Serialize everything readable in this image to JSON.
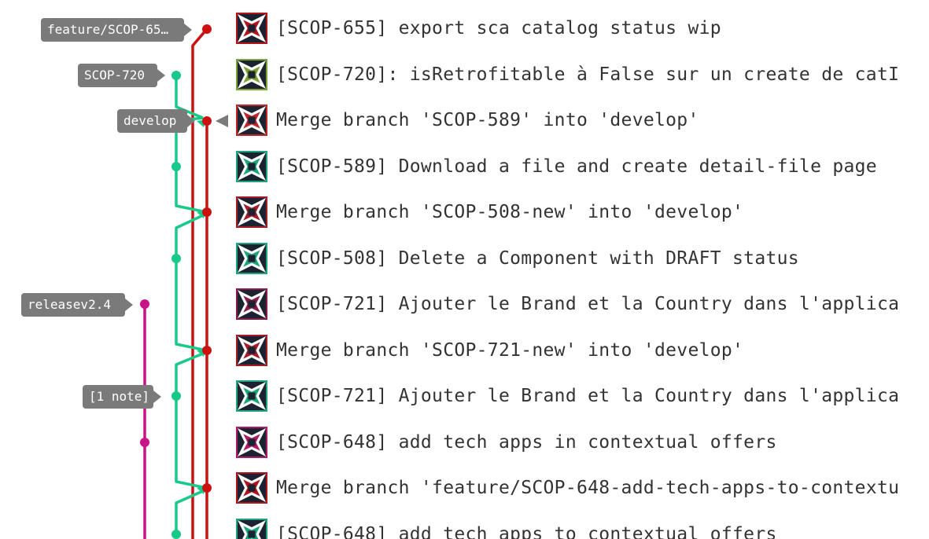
{
  "colors": {
    "red": "#cc1111",
    "green": "#18c98a",
    "magenta": "#c71585",
    "label_bg": "#7a7a7a",
    "text": "#333333"
  },
  "refs": {
    "feature": "feature/SCOP-65…",
    "scop720": "SCOP-720",
    "develop": "develop",
    "release": "releasev2.4",
    "note": "[1 note]"
  },
  "commits": [
    {
      "message": "[SCOP-655] export sca catalog status wip",
      "avatar_color": "#b3141c"
    },
    {
      "message": "[SCOP-720]: isRetrofitable à False sur un create de catI",
      "avatar_color": "#7aa432"
    },
    {
      "message": "Merge branch 'SCOP-589' into 'develop'",
      "avatar_color": "#c0252a"
    },
    {
      "message": "[SCOP-589] Download a file and create detail-file page",
      "avatar_color": "#1aa57c"
    },
    {
      "message": "Merge branch 'SCOP-508-new' into 'develop'",
      "avatar_color": "#a51b2a"
    },
    {
      "message": "[SCOP-508] Delete a Component with DRAFT status",
      "avatar_color": "#1aa57c"
    },
    {
      "message": "[SCOP-721] Ajouter le Brand et la Country dans l'applica",
      "avatar_color": "#8a1a4a"
    },
    {
      "message": "Merge branch 'SCOP-721-new' into 'develop'",
      "avatar_color": "#a51b2a"
    },
    {
      "message": "[SCOP-721] Ajouter le Brand et la Country dans l'applica",
      "avatar_color": "#1aa57c"
    },
    {
      "message": "[SCOP-648] add tech apps in contextual offers",
      "avatar_color": "#b01a6a"
    },
    {
      "message": "Merge branch 'feature/SCOP-648-add-tech-apps-to-contextu",
      "avatar_color": "#b3141c"
    },
    {
      "message": "[SCOP-648] add tech apps to contextual offers",
      "avatar_color": "#1aa57c"
    }
  ]
}
